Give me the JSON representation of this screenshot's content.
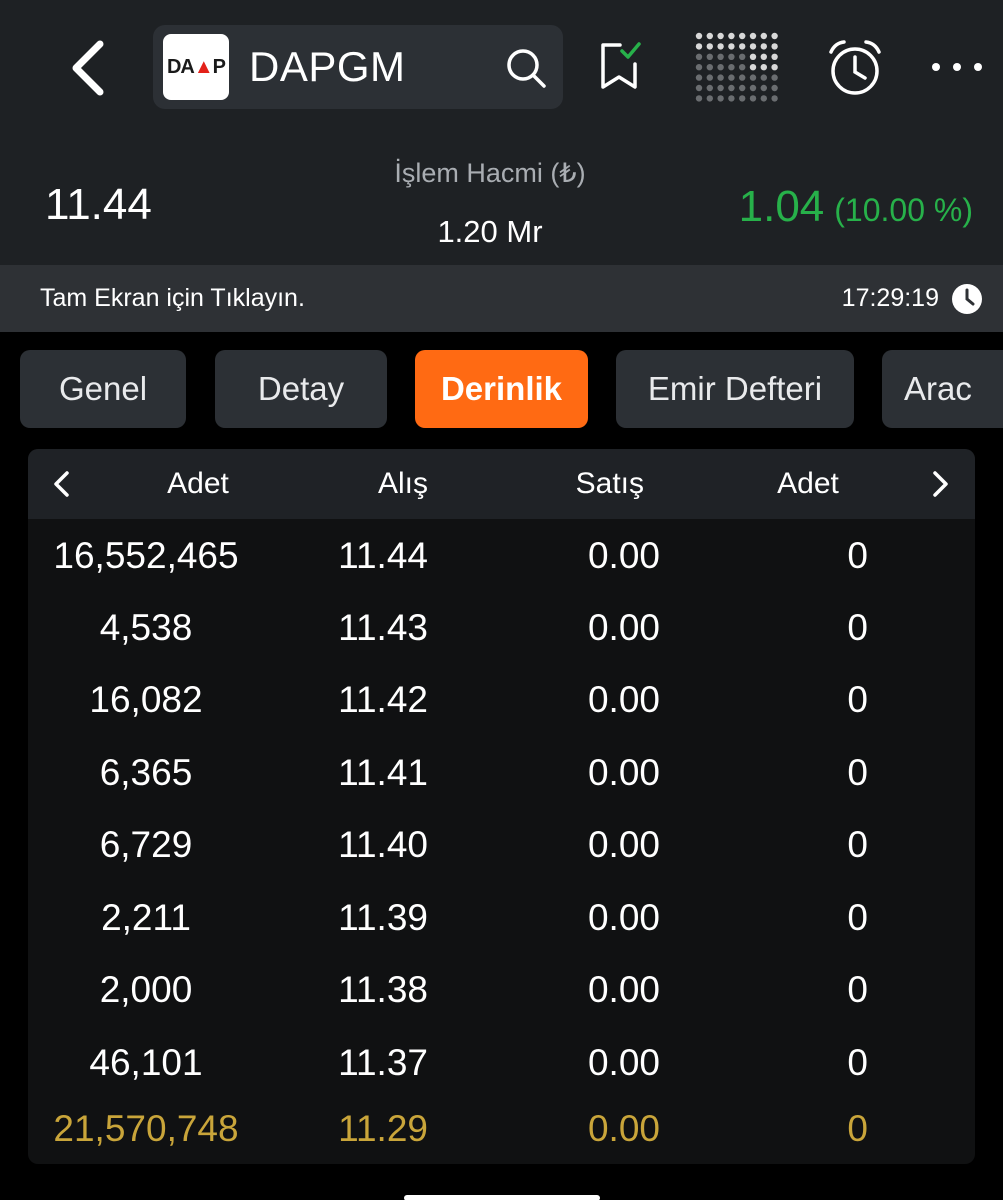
{
  "header": {
    "symbol": "DAPGM",
    "logo_text_left": "DA",
    "logo_text_right": "P",
    "icons": [
      "back-chevron-icon",
      "search-icon",
      "bookmark-check-icon",
      "dot-matrix-icon",
      "alarm-clock-icon",
      "more-dots-icon"
    ]
  },
  "quote": {
    "price": "11.44",
    "volume_label": "İşlem Hacmi (₺)",
    "volume_value": "1.20 Mr",
    "change_value": "1.04",
    "change_percent": "(10.00 %)"
  },
  "infobar": {
    "fullscreen_text": "Tam Ekran için Tıklayın.",
    "time": "17:29:19"
  },
  "tabs": [
    {
      "label": "Genel",
      "active": false
    },
    {
      "label": "Detay",
      "active": false
    },
    {
      "label": "Derinlik",
      "active": true
    },
    {
      "label": "Emir Defteri",
      "active": false
    },
    {
      "label": "Arac",
      "active": false
    }
  ],
  "depth": {
    "columns": [
      "Adet",
      "Alış",
      "Satış",
      "Adet"
    ],
    "rows": [
      {
        "bid_qty": "16,552,465",
        "bid": "11.44",
        "ask": "0.00",
        "ask_qty": "0"
      },
      {
        "bid_qty": "4,538",
        "bid": "11.43",
        "ask": "0.00",
        "ask_qty": "0"
      },
      {
        "bid_qty": "16,082",
        "bid": "11.42",
        "ask": "0.00",
        "ask_qty": "0"
      },
      {
        "bid_qty": "6,365",
        "bid": "11.41",
        "ask": "0.00",
        "ask_qty": "0"
      },
      {
        "bid_qty": "6,729",
        "bid": "11.40",
        "ask": "0.00",
        "ask_qty": "0"
      },
      {
        "bid_qty": "2,211",
        "bid": "11.39",
        "ask": "0.00",
        "ask_qty": "0"
      },
      {
        "bid_qty": "2,000",
        "bid": "11.38",
        "ask": "0.00",
        "ask_qty": "0"
      },
      {
        "bid_qty": "46,101",
        "bid": "11.37",
        "ask": "0.00",
        "ask_qty": "0"
      },
      {
        "bid_qty": "21,570,748",
        "bid": "11.29",
        "ask": "0.00",
        "ask_qty": "0",
        "highlight": true
      }
    ]
  },
  "colors": {
    "accent": "#ff6a13",
    "positive": "#27b14a",
    "highlight_row": "#c9a53a",
    "background": "#000000",
    "panel": "#1e2124"
  }
}
